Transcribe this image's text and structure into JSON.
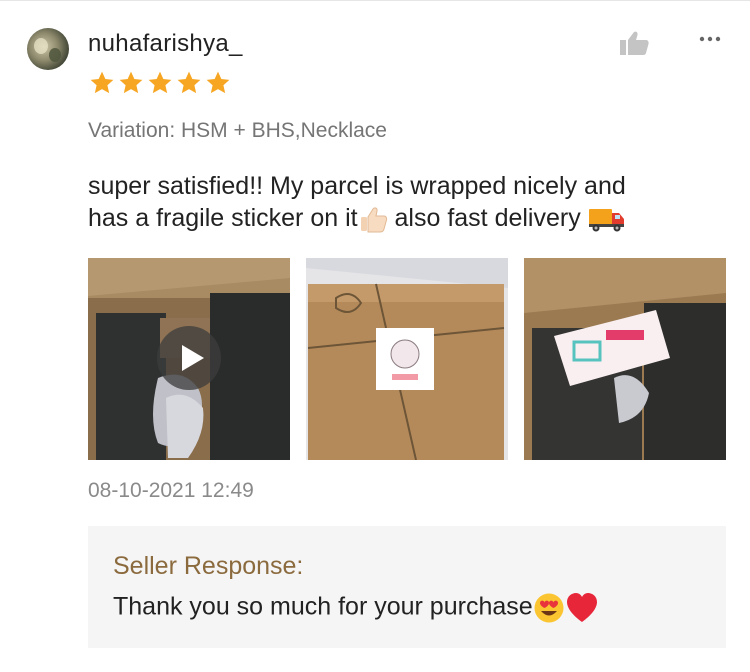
{
  "review": {
    "username": "nuhafarishya_",
    "rating": 5,
    "variation": "Variation: HSM + BHS,Necklace",
    "text_line1": "super satisfied!! My parcel is wrapped nicely and",
    "text_line2a": "has a fragile sticker on it",
    "text_line2b": " also fast delivery ",
    "timestamp": "08-10-2021 12:49",
    "media_count": 3,
    "icons": [
      "thumbs-up-icon",
      "more-icon",
      "star-icon",
      "play-icon",
      "thumbs-up-emoji",
      "delivery-truck-emoji",
      "heart-eyes-emoji",
      "red-heart-emoji"
    ]
  },
  "seller_response": {
    "title": "Seller Response:",
    "message": "Thank you so much for your purchase"
  },
  "colors": {
    "star": "#f6a623",
    "seller_title": "#8b6b3e",
    "muted": "#757575",
    "seller_box": "#f5f5f5"
  }
}
